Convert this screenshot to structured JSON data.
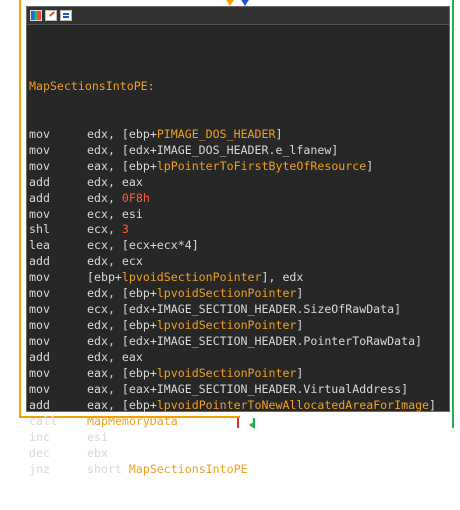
{
  "titlebar": {
    "icons": [
      "color-icon",
      "edit-icon",
      "graph-icon"
    ]
  },
  "block": {
    "label": "MapSectionsIntoPE:",
    "lines": [
      {
        "mn": "mov",
        "ops": [
          [
            "plain",
            "edx, ["
          ],
          [
            "plain",
            "ebp+"
          ],
          [
            "sym",
            "PIMAGE_DOS_HEADER"
          ],
          [
            "plain",
            "]"
          ]
        ]
      },
      {
        "mn": "mov",
        "ops": [
          [
            "plain",
            "edx, [edx+IMAGE_DOS_HEADER.e_lfanew]"
          ]
        ]
      },
      {
        "mn": "mov",
        "ops": [
          [
            "plain",
            "eax, [ebp+"
          ],
          [
            "sym",
            "lpPointerToFirstByteOfResource"
          ],
          [
            "plain",
            "]"
          ]
        ]
      },
      {
        "mn": "add",
        "ops": [
          [
            "plain",
            "edx, eax"
          ]
        ]
      },
      {
        "mn": "add",
        "ops": [
          [
            "plain",
            "edx, "
          ],
          [
            "num",
            "0F8h"
          ]
        ]
      },
      {
        "mn": "mov",
        "ops": [
          [
            "plain",
            "ecx, esi"
          ]
        ]
      },
      {
        "mn": "shl",
        "ops": [
          [
            "plain",
            "ecx, "
          ],
          [
            "num",
            "3"
          ]
        ]
      },
      {
        "mn": "lea",
        "ops": [
          [
            "plain",
            "ecx, [ecx+ecx*4]"
          ]
        ]
      },
      {
        "mn": "add",
        "ops": [
          [
            "plain",
            "edx, ecx"
          ]
        ]
      },
      {
        "mn": "mov",
        "ops": [
          [
            "plain",
            "[ebp+"
          ],
          [
            "sym",
            "lpvoidSectionPointer"
          ],
          [
            "plain",
            "], edx"
          ]
        ]
      },
      {
        "mn": "mov",
        "ops": [
          [
            "plain",
            "edx, [ebp+"
          ],
          [
            "sym",
            "lpvoidSectionPointer"
          ],
          [
            "plain",
            "]"
          ]
        ]
      },
      {
        "mn": "mov",
        "ops": [
          [
            "plain",
            "ecx, [edx+IMAGE_SECTION_HEADER.SizeOfRawData]"
          ]
        ]
      },
      {
        "mn": "mov",
        "ops": [
          [
            "plain",
            "edx, [ebp+"
          ],
          [
            "sym",
            "lpvoidSectionPointer"
          ],
          [
            "plain",
            "]"
          ]
        ]
      },
      {
        "mn": "mov",
        "ops": [
          [
            "plain",
            "edx, [edx+IMAGE_SECTION_HEADER.PointerToRawData]"
          ]
        ]
      },
      {
        "mn": "add",
        "ops": [
          [
            "plain",
            "edx, eax"
          ]
        ]
      },
      {
        "mn": "mov",
        "ops": [
          [
            "plain",
            "eax, [ebp+"
          ],
          [
            "sym",
            "lpvoidSectionPointer"
          ],
          [
            "plain",
            "]"
          ]
        ]
      },
      {
        "mn": "mov",
        "ops": [
          [
            "plain",
            "eax, [eax+IMAGE_SECTION_HEADER.VirtualAddress]"
          ]
        ]
      },
      {
        "mn": "add",
        "ops": [
          [
            "plain",
            "eax, [ebp+"
          ],
          [
            "sym",
            "lpvoidPointerToNewAllocatedAreaForImage"
          ],
          [
            "plain",
            "]"
          ]
        ]
      },
      {
        "mn": "call",
        "ops": [
          [
            "sym",
            "MapMemoryData"
          ]
        ]
      },
      {
        "mn": "inc",
        "ops": [
          [
            "plain",
            "esi"
          ]
        ]
      },
      {
        "mn": "dec",
        "ops": [
          [
            "plain",
            "ebx"
          ]
        ]
      },
      {
        "mn": "jnz",
        "ops": [
          [
            "plain",
            "short "
          ],
          [
            "sym",
            "MapSectionsIntoPE"
          ]
        ]
      }
    ]
  },
  "colors": {
    "background": "#272727",
    "text": "#d8d8d8",
    "symbol": "#f0a020",
    "number": "#ff5a3a",
    "edge_left": "#f4a000",
    "edge_right": "#22b14c",
    "edge_red": "#e03030"
  }
}
